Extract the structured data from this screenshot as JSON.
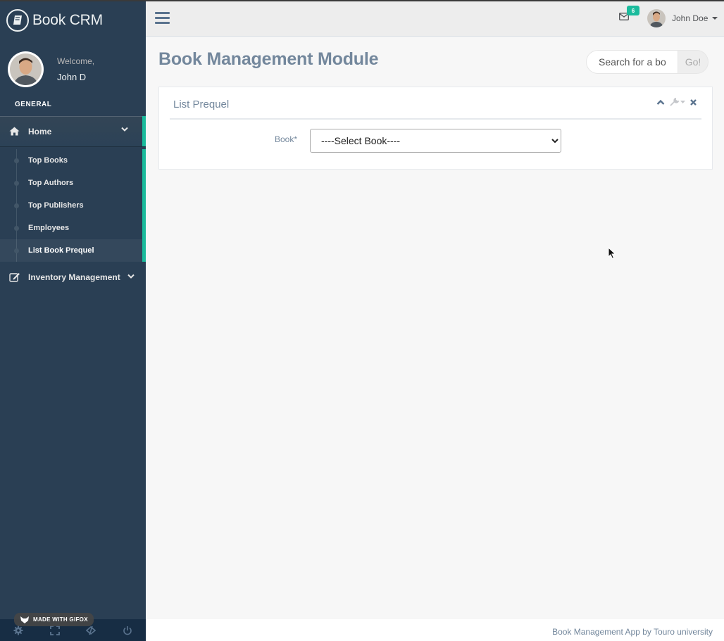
{
  "sidebar": {
    "brand": {
      "title": "Book CRM",
      "icon": "book-icon"
    },
    "profile": {
      "welcome": "Welcome,",
      "name": "John D"
    },
    "section_title": "GENERAL",
    "home": {
      "label": "Home",
      "icon": "home-icon"
    },
    "children": [
      {
        "label": "Top Books"
      },
      {
        "label": "Top Authors"
      },
      {
        "label": "Top Publishers"
      },
      {
        "label": "Employees"
      },
      {
        "label": "List Book Prequel",
        "active": true
      }
    ],
    "inventory": {
      "label": "Inventory Management",
      "icon": "edit-icon"
    },
    "footer_icons": [
      "settings-icon",
      "fullscreen-icon",
      "lock-icon",
      "logout-icon"
    ],
    "gifox_badge": "MADE WITH GIFOX"
  },
  "topnav": {
    "mail_count": "6",
    "user_name": "John Doe"
  },
  "main": {
    "title": "Book Management Module",
    "search": {
      "placeholder": "Search for a bo",
      "button": "Go!"
    },
    "panel": {
      "title": "List Prequel",
      "field_label": "Book*",
      "select_value": "----Select Book----"
    }
  },
  "footer": {
    "text": "Book Management App by Touro university"
  },
  "colors": {
    "sidebar": "#2a3f54",
    "accent": "#1abb9c",
    "text": "#73879c"
  }
}
